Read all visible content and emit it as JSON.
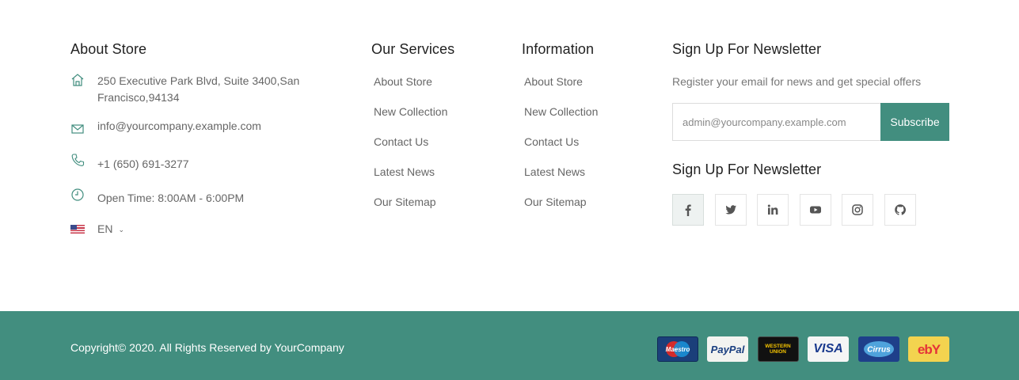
{
  "about": {
    "title": "About Store",
    "address": "250 Executive Park Blvd, Suite 3400,San Francisco,94134",
    "email": "info@yourcompany.example.com",
    "phone": "+1 (650) 691-3277",
    "hours": "Open Time: 8:00AM - 6:00PM",
    "language": "EN"
  },
  "services": {
    "title": "Our Services",
    "links": [
      "About Store",
      "New Collection",
      "Contact Us",
      "Latest News",
      "Our Sitemap"
    ]
  },
  "information": {
    "title": "Information",
    "links": [
      "About Store",
      "New Collection",
      "Contact Us",
      "Latest News",
      "Our Sitemap"
    ]
  },
  "newsletter": {
    "title": "Sign Up For Newsletter",
    "description": "Register your email for news and get special offers",
    "email_value": "admin@yourcompany.example.com",
    "subscribe_label": "Subscribe",
    "social_title": "Sign Up For Newsletter",
    "social": [
      "facebook-icon",
      "twitter-icon",
      "linkedin-icon",
      "youtube-icon",
      "instagram-icon",
      "github-icon"
    ]
  },
  "bottom": {
    "copyright": "Copyright© 2020. All Rights Reserved by YourCompany",
    "payments": {
      "maestro": "Maestro",
      "paypal": "PayPal",
      "western_union": "WESTERN UNION",
      "visa": "VISA",
      "cirrus": "Cirrus",
      "ebay": "ebY"
    }
  },
  "colors": {
    "accent": "#428e7f",
    "heading": "#222222",
    "text": "#666666"
  }
}
